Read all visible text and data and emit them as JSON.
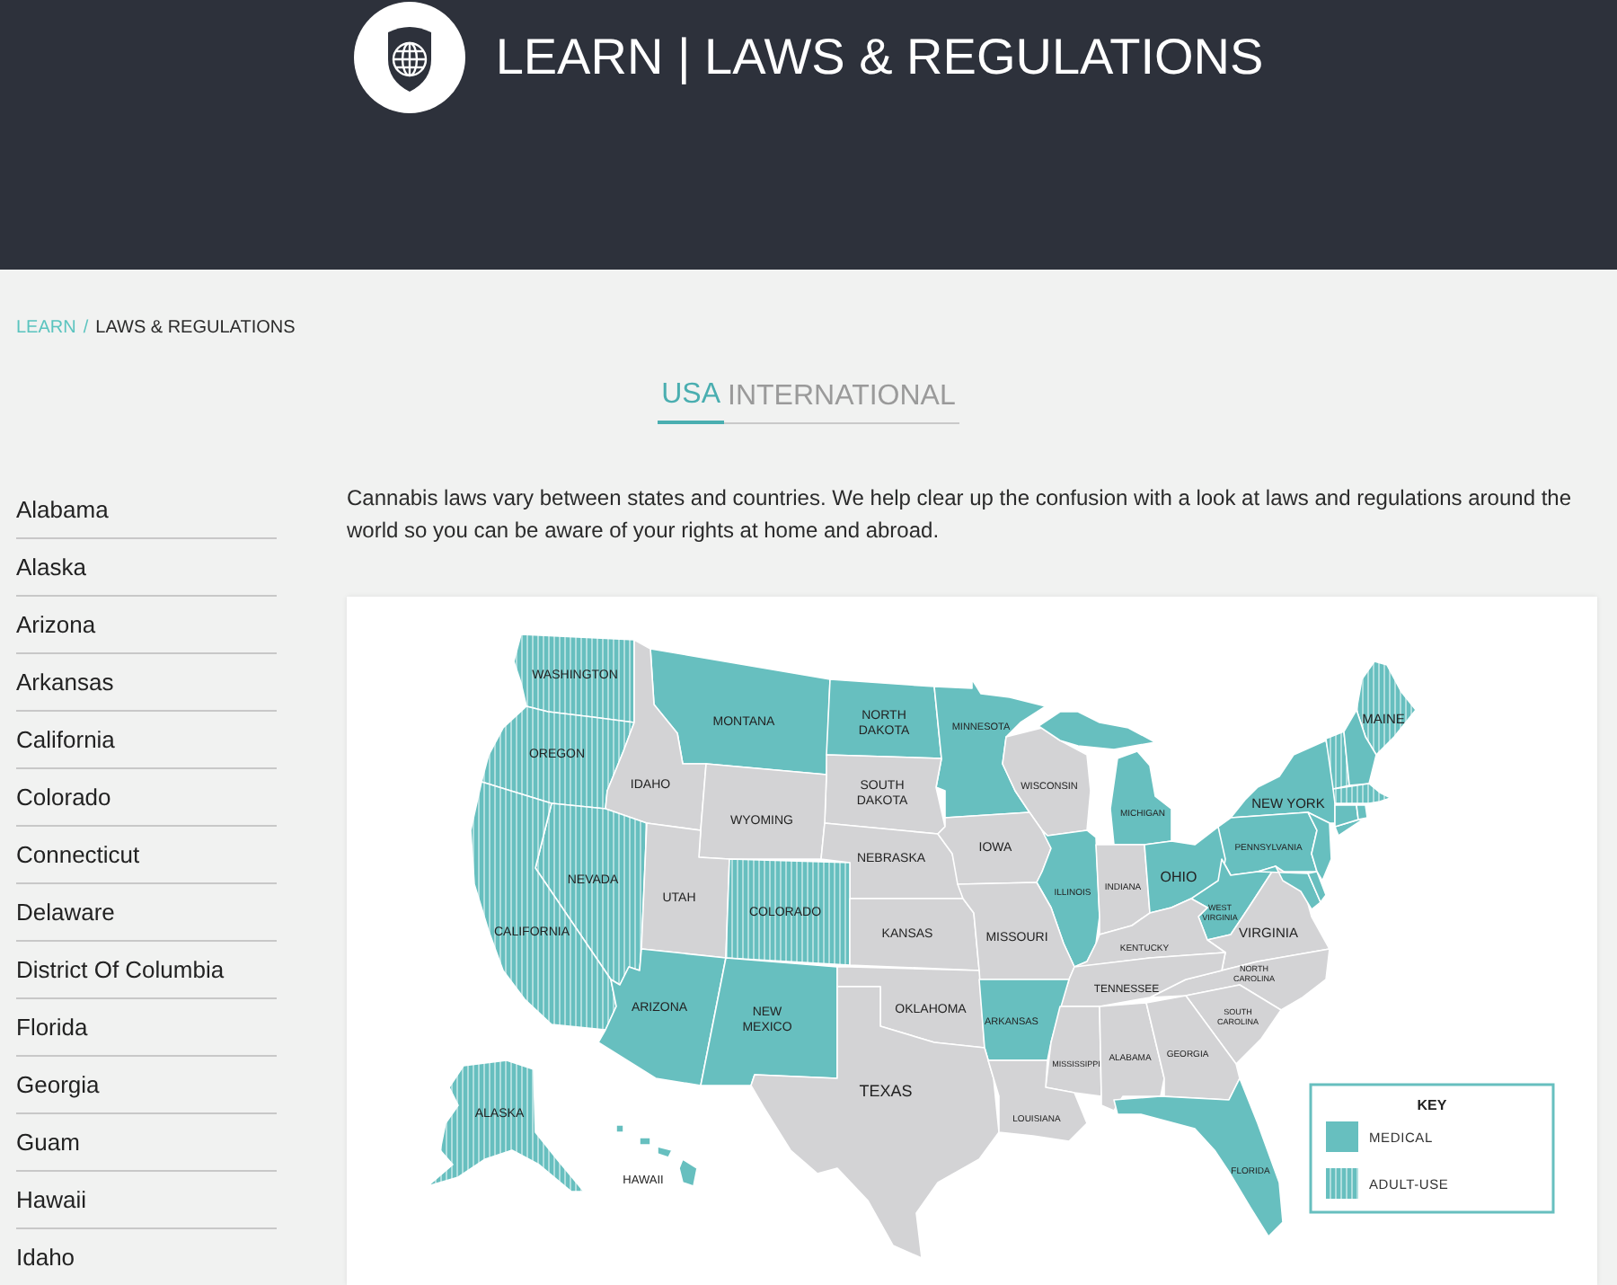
{
  "header": {
    "title": "LEARN | LAWS & REGULATIONS"
  },
  "breadcrumb": {
    "separator": "/",
    "items": [
      {
        "label": "LEARN",
        "current": false
      },
      {
        "label": "LAWS & REGULATIONS",
        "current": true
      }
    ]
  },
  "tabs": [
    {
      "label": "USA",
      "selected": true
    },
    {
      "label": "INTERNATIONAL",
      "selected": false
    }
  ],
  "sidebar": {
    "items": [
      "Alabama",
      "Alaska",
      "Arizona",
      "Arkansas",
      "California",
      "Colorado",
      "Connecticut",
      "Delaware",
      "District Of Columbia",
      "Florida",
      "Georgia",
      "Guam",
      "Hawaii",
      "Idaho"
    ]
  },
  "intro": "Cannabis laws vary between states and countries. We help clear up the confusion with a look at laws and regulations around the world so you can be aware of your rights at home and abroad.",
  "map": {
    "states": [
      {
        "label": "WASHINGTON",
        "kind": "adult_use"
      },
      {
        "label": "MONTANA",
        "kind": "medical"
      },
      {
        "label": "NORTH DAKOTA",
        "kind": "medical"
      },
      {
        "label": "MINNESOTA",
        "kind": "medical"
      },
      {
        "label": "MAINE",
        "kind": "adult_use"
      },
      {
        "label": "OREGON",
        "kind": "adult_use"
      },
      {
        "label": "IDAHO",
        "kind": "none"
      },
      {
        "label": "SOUTH DAKOTA",
        "kind": "none"
      },
      {
        "label": "WISCONSIN",
        "kind": "none"
      },
      {
        "label": "NEW YORK",
        "kind": "medical"
      },
      {
        "label": "WYOMING",
        "kind": "none"
      },
      {
        "label": "MICHIGAN",
        "kind": "medical"
      },
      {
        "label": "NEBRASKA",
        "kind": "none"
      },
      {
        "label": "IOWA",
        "kind": "none"
      },
      {
        "label": "PENNSYLVANIA",
        "kind": "medical"
      },
      {
        "label": "NEVADA",
        "kind": "adult_use"
      },
      {
        "label": "UTAH",
        "kind": "none"
      },
      {
        "label": "ILLINOIS",
        "kind": "medical"
      },
      {
        "label": "INDIANA",
        "kind": "none"
      },
      {
        "label": "OHIO",
        "kind": "medical"
      },
      {
        "label": "COLORADO",
        "kind": "adult_use"
      },
      {
        "label": "WEST VIRGINIA",
        "kind": "medical"
      },
      {
        "label": "CALIFORNIA",
        "kind": "adult_use"
      },
      {
        "label": "KANSAS",
        "kind": "none"
      },
      {
        "label": "MISSOURI",
        "kind": "none"
      },
      {
        "label": "VIRGINIA",
        "kind": "none"
      },
      {
        "label": "KENTUCKY",
        "kind": "none"
      },
      {
        "label": "NORTH CAROLINA",
        "kind": "none"
      },
      {
        "label": "TENNESSEE",
        "kind": "none"
      },
      {
        "label": "ARIZONA",
        "kind": "medical"
      },
      {
        "label": "NEW MEXICO",
        "kind": "medical"
      },
      {
        "label": "OKLAHOMA",
        "kind": "none"
      },
      {
        "label": "ARKANSAS",
        "kind": "medical"
      },
      {
        "label": "SOUTH CAROLINA",
        "kind": "none"
      },
      {
        "label": "MISSISSIPPI",
        "kind": "none"
      },
      {
        "label": "ALABAMA",
        "kind": "none"
      },
      {
        "label": "GEORGIA",
        "kind": "none"
      },
      {
        "label": "TEXAS",
        "kind": "none"
      },
      {
        "label": "ALASKA",
        "kind": "adult_use"
      },
      {
        "label": "LOUISIANA",
        "kind": "none"
      },
      {
        "label": "HAWAII",
        "kind": "medical"
      },
      {
        "label": "FLORIDA",
        "kind": "medical"
      }
    ],
    "small_states": [
      {
        "kind": "adult_use"
      },
      {
        "kind": "medical"
      },
      {
        "kind": "adult_use"
      },
      {
        "kind": "medical"
      },
      {
        "kind": "medical"
      },
      {
        "kind": "medical"
      },
      {
        "kind": "medical"
      },
      {
        "kind": "medical"
      }
    ],
    "legend": {
      "title": "KEY",
      "items": [
        {
          "label": "MEDICAL",
          "kind": "medical"
        },
        {
          "label": "ADULT-USE",
          "kind": "adult_use"
        }
      ]
    }
  }
}
